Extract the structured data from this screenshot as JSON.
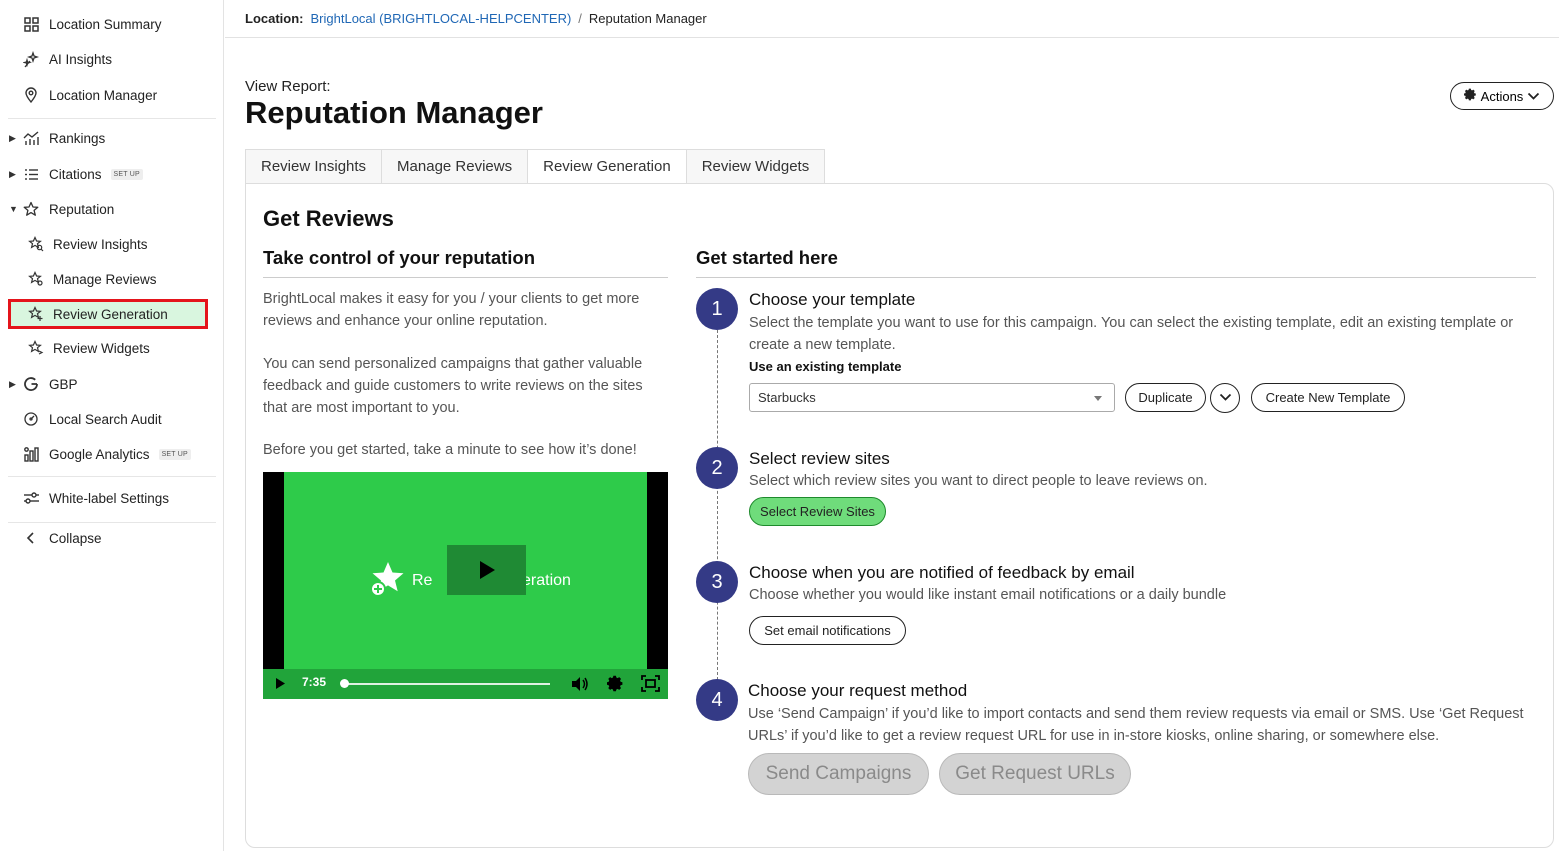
{
  "sidebar": {
    "items": [
      {
        "label": "Location Summary",
        "icon": "grid-icon"
      },
      {
        "label": "AI Insights",
        "icon": "sparkle-icon"
      },
      {
        "label": "Location Manager",
        "icon": "map-pin-icon"
      },
      {
        "label": "Rankings",
        "icon": "chart-icon"
      },
      {
        "label": "Citations",
        "icon": "list-icon",
        "badge": "SET UP"
      },
      {
        "label": "Reputation",
        "icon": "star-icon"
      },
      {
        "label": "Review Insights",
        "icon": "star-search-icon"
      },
      {
        "label": "Manage Reviews",
        "icon": "star-gear-icon"
      },
      {
        "label": "Review Generation",
        "icon": "star-plus-icon"
      },
      {
        "label": "Review Widgets",
        "icon": "star-widget-icon"
      },
      {
        "label": "GBP",
        "icon": "google-icon"
      },
      {
        "label": "Local Search Audit",
        "icon": "audit-icon"
      },
      {
        "label": "Google Analytics",
        "icon": "analytics-icon",
        "badge": "SET UP"
      },
      {
        "label": "White-label Settings",
        "icon": "sliders-icon"
      },
      {
        "label": "Collapse",
        "icon": "chevron-left-icon"
      }
    ]
  },
  "breadcrumb": {
    "location_label": "Location:",
    "location_name": "BrightLocal (BRIGHTLOCAL-HELPCENTER)",
    "separator": "/",
    "current": "Reputation Manager"
  },
  "header": {
    "view_report": "View Report:",
    "title": "Reputation Manager",
    "actions_label": "Actions"
  },
  "tabs": [
    {
      "label": "Review Insights"
    },
    {
      "label": "Manage Reviews"
    },
    {
      "label": "Review Generation",
      "active": true
    },
    {
      "label": "Review Widgets"
    }
  ],
  "main": {
    "heading": "Get Reviews",
    "left": {
      "subheading": "Take control of your reputation",
      "p1": "BrightLocal makes it easy for you / your clients to get more reviews and enhance your online reputation.",
      "p2": "You can send personalized campaigns that gather valuable feedback and guide customers to write reviews on the sites that are most important to you.",
      "p3": "Before you get started, take a minute to see how it’s done!",
      "video": {
        "title_left": "Re",
        "title_right": "eration",
        "time": "7:35"
      }
    },
    "right": {
      "subheading": "Get started here",
      "steps": [
        {
          "num": "1",
          "title": "Choose your template",
          "desc": "Select the template you want to use for this campaign. You can select the existing template, edit an existing template or create a new template.",
          "field_label": "Use an existing template",
          "select_value": "Starbucks",
          "duplicate_label": "Duplicate",
          "create_label": "Create New Template"
        },
        {
          "num": "2",
          "title": "Select review sites",
          "desc": "Select which review sites you want to direct people to leave reviews on.",
          "button_label": "Select Review Sites"
        },
        {
          "num": "3",
          "title": "Choose when you are notified of feedback by email",
          "desc": "Choose whether you would like instant email notifications or a daily bundle",
          "button_label": "Set email notifications"
        },
        {
          "num": "4",
          "title": "Choose your request method",
          "desc": "Use ‘Send Campaign’ if you’d like to import contacts and send them review requests via email or SMS. Use ‘Get Request URLs’ if you’d like to get a review request URL for use in in-store kiosks, online sharing, or somewhere else.",
          "send_label": "Send Campaigns",
          "urls_label": "Get Request URLs"
        }
      ]
    }
  },
  "colors": {
    "accent_navy": "#343a86",
    "link_blue": "#1f67b5",
    "highlight_red": "#e4141b",
    "active_green": "#d9f6df",
    "video_green": "#2ecb4a"
  }
}
